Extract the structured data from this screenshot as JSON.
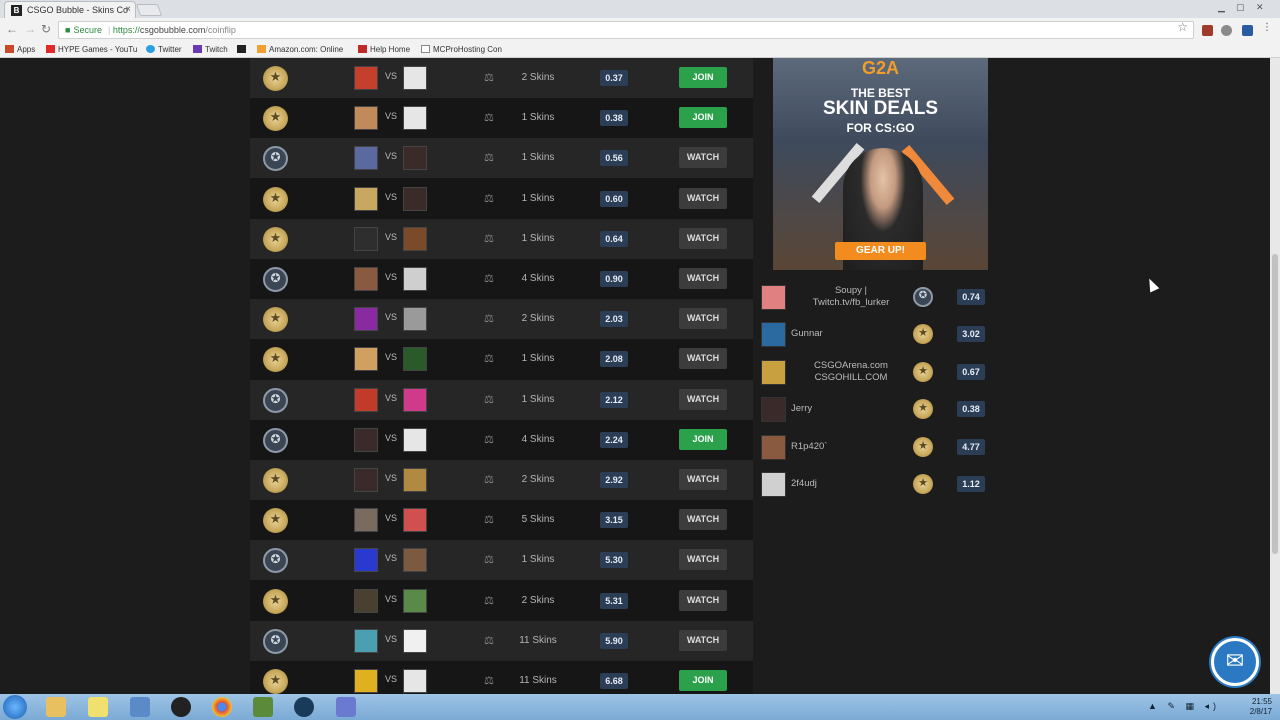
{
  "browser": {
    "tab_title": "CSGO Bubble - Skins Co",
    "favicon_letter": "B",
    "tab_close": "×",
    "url_security": "Secure",
    "url_scheme": "https://",
    "url_host": "csgobubble.com",
    "url_path": "/coinflip",
    "bookmarks": [
      "Apps",
      "HYPE Games - YouTu",
      "Twitter",
      "Twitch",
      "",
      "Amazon.com: Online",
      "Help Home",
      "MCProHosting Con"
    ]
  },
  "games": [
    {
      "side": "t",
      "skins": "2 Skins",
      "value": "0.37",
      "action": "JOIN",
      "a1": "#c4402c",
      "a2": "#e6e6e6"
    },
    {
      "side": "t",
      "skins": "1 Skins",
      "value": "0.38",
      "action": "JOIN",
      "a1": "#c08a5a",
      "a2": "#e6e6e6"
    },
    {
      "side": "ct",
      "skins": "1 Skins",
      "value": "0.56",
      "action": "WATCH",
      "a1": "#5a6aa0",
      "a2": "#3a2a28"
    },
    {
      "side": "t",
      "skins": "1 Skins",
      "value": "0.60",
      "action": "WATCH",
      "a1": "#c8a860",
      "a2": "#3a2a28"
    },
    {
      "side": "t",
      "skins": "1 Skins",
      "value": "0.64",
      "action": "WATCH",
      "a1": "#2e2e2e",
      "a2": "#7a4a2a"
    },
    {
      "side": "ct",
      "skins": "4 Skins",
      "value": "0.90",
      "action": "WATCH",
      "a1": "#8a5a40",
      "a2": "#cfcfcf"
    },
    {
      "side": "t",
      "skins": "2 Skins",
      "value": "2.03",
      "action": "WATCH",
      "a1": "#8a2aa0",
      "a2": "#9a9a9a"
    },
    {
      "side": "t",
      "skins": "1 Skins",
      "value": "2.08",
      "action": "WATCH",
      "a1": "#d0a060",
      "a2": "#2a5a2a"
    },
    {
      "side": "ct",
      "skins": "1 Skins",
      "value": "2.12",
      "action": "WATCH",
      "a1": "#c23a2a",
      "a2": "#d03a8a"
    },
    {
      "side": "ct",
      "skins": "4 Skins",
      "value": "2.24",
      "action": "JOIN",
      "a1": "#3a2a2a",
      "a2": "#e6e6e6"
    },
    {
      "side": "t",
      "skins": "2 Skins",
      "value": "2.92",
      "action": "WATCH",
      "a1": "#3a2a2a",
      "a2": "#b08a40"
    },
    {
      "side": "t",
      "skins": "5 Skins",
      "value": "3.15",
      "action": "WATCH",
      "a1": "#7a6a60",
      "a2": "#d05050"
    },
    {
      "side": "ct",
      "skins": "1 Skins",
      "value": "5.30",
      "action": "WATCH",
      "a1": "#2a3ad0",
      "a2": "#7a5a40"
    },
    {
      "side": "t",
      "skins": "2 Skins",
      "value": "5.31",
      "action": "WATCH",
      "a1": "#4a4030",
      "a2": "#5a8a4a"
    },
    {
      "side": "ct",
      "skins": "11 Skins",
      "value": "5.90",
      "action": "WATCH",
      "a1": "#4aa0b0",
      "a2": "#f0f0f0"
    },
    {
      "side": "t",
      "skins": "11 Skins",
      "value": "6.68",
      "action": "JOIN",
      "a1": "#e0b020",
      "a2": "#e6e6e6"
    }
  ],
  "vs_label": "VS",
  "ad": {
    "logo": "G2A",
    "line1": "THE BEST",
    "line2": "SKIN DEALS",
    "line3": "FOR CS:GO",
    "cta": "GEAR UP!"
  },
  "players": [
    {
      "name": "Soupy | Twitch.tv/fb_lurker",
      "side": "ct",
      "value": "0.74",
      "av": "#e08080",
      "centered": true
    },
    {
      "name": "Gunnar",
      "side": "t",
      "value": "3.02",
      "av": "#2a6aa0",
      "centered": false
    },
    {
      "name": "CSGOArena.com CSGOHILL.COM",
      "side": "t",
      "value": "0.67",
      "av": "#c8a040",
      "centered": true
    },
    {
      "name": "Jerry",
      "side": "t",
      "value": "0.38",
      "av": "#3a2a2a",
      "centered": false
    },
    {
      "name": "R1p420`",
      "side": "t",
      "value": "4.77",
      "av": "#8a5a40",
      "centered": false
    },
    {
      "name": "2f4udj",
      "side": "t",
      "value": "1.12",
      "av": "#d0d0d0",
      "centered": false
    }
  ],
  "icons": {
    "t_side": "★",
    "ct_side": "✪",
    "coin": "⚖",
    "chat": "✉",
    "back": "←",
    "forward": "→",
    "reload": "↻",
    "bookmark_star": "☆"
  },
  "taskbar": {
    "time": "21:55",
    "date": "2/8/17"
  },
  "colors": {
    "join": "#2aa14a",
    "watch": "#3c3c3c",
    "value_badge": "#2c3e56",
    "ad_cta": "#f28c1e"
  }
}
